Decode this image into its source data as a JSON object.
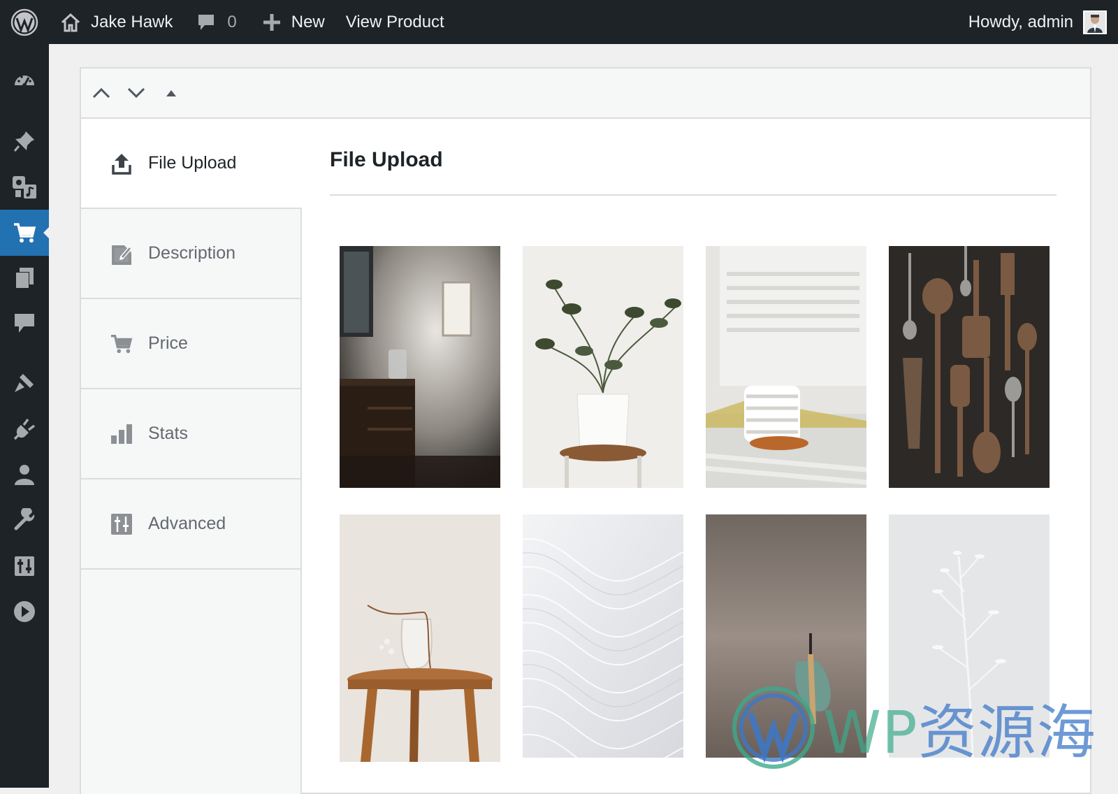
{
  "admin_bar": {
    "site_name": "Jake Hawk",
    "comment_count": "0",
    "new_label": "New",
    "view_label": "View Product",
    "greeting": "Howdy, admin",
    "icons": [
      "wordpress-logo-icon",
      "home-icon",
      "comment-bubble-icon",
      "plus-icon",
      "avatar"
    ]
  },
  "side_menu": {
    "icons": [
      "dashboard-icon",
      "pin-icon",
      "media-icon",
      "cart-icon",
      "pages-icon",
      "comments-icon",
      "appearance-icon",
      "plugins-icon",
      "users-icon",
      "tools-icon",
      "settings-icon",
      "play-icon"
    ],
    "current": "cart-icon"
  },
  "panel": {
    "header_controls": [
      "move-up",
      "move-down",
      "collapse"
    ],
    "tabs": [
      {
        "label": "File Upload",
        "icon": "upload-icon",
        "active": true
      },
      {
        "label": "Description",
        "icon": "edit-icon",
        "active": false
      },
      {
        "label": "Price",
        "icon": "cart-icon",
        "active": false
      },
      {
        "label": "Stats",
        "icon": "bar-chart-icon",
        "active": false
      },
      {
        "label": "Advanced",
        "icon": "sliders-icon",
        "active": false
      }
    ],
    "content_title": "File Upload",
    "images": [
      "room-shelf-frame",
      "potted-plant-stool",
      "mug-striped-light",
      "wooden-spoons",
      "vase-on-stool",
      "white-wave-texture",
      "scoop-on-wall",
      "dried-white-branch"
    ]
  },
  "watermark": {
    "latin": "WP",
    "cjk": "资源海"
  },
  "colors": {
    "adminbar": "#1d2327",
    "accent": "#2271b1",
    "panel_bg": "#f6f7f7"
  }
}
